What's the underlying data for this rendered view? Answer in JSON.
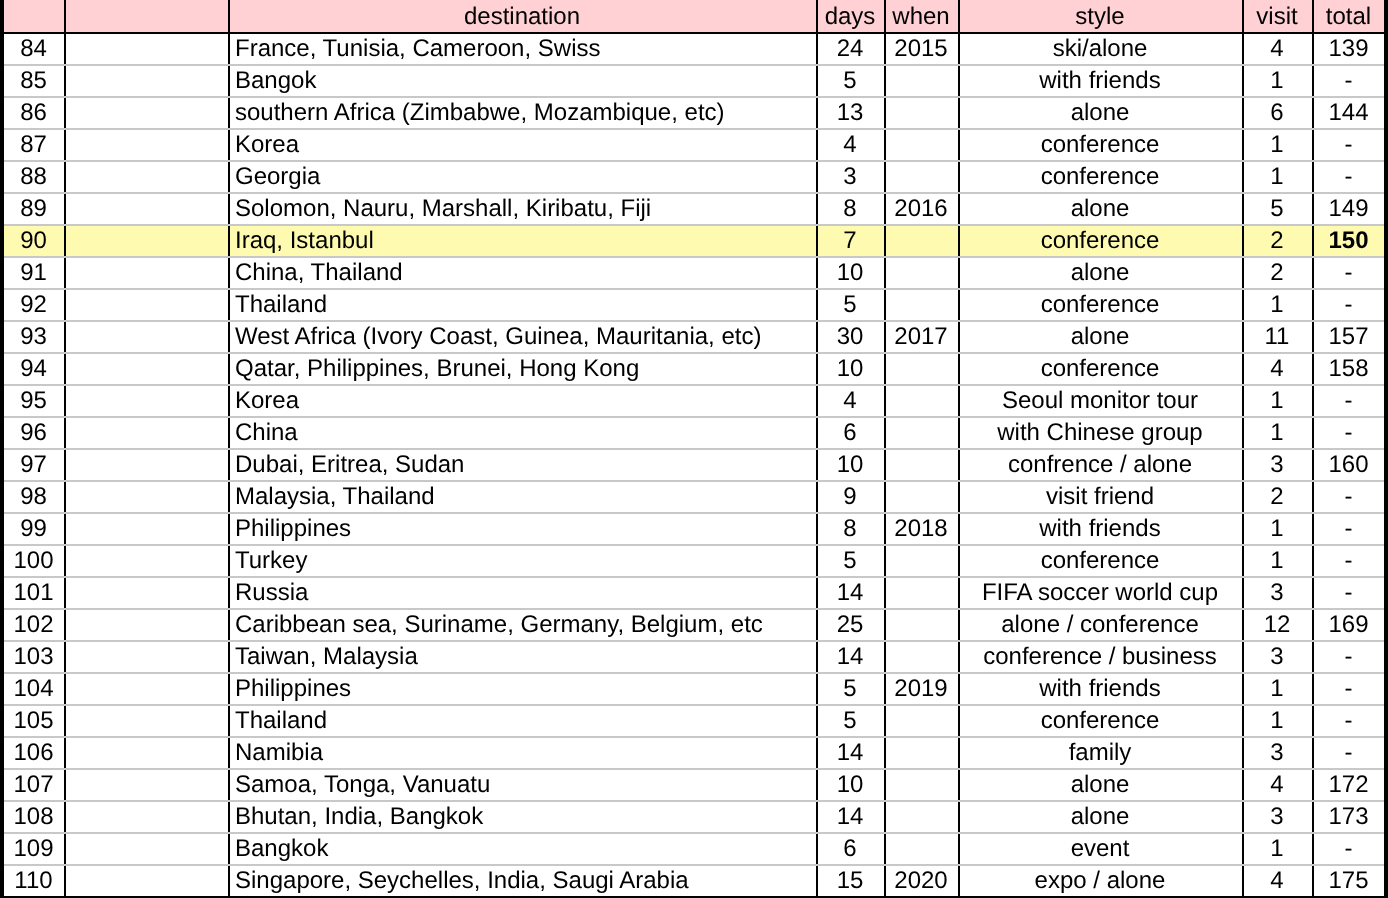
{
  "table": {
    "columns": [
      "destination",
      "days",
      "when",
      "style",
      "visit",
      "total"
    ],
    "rows": [
      {
        "no": "84",
        "destination": "France, Tunisia, Cameroon, Swiss",
        "days": "24",
        "when": "2015",
        "style": "ski/alone",
        "visit": "4",
        "total": "139",
        "highlighted": false
      },
      {
        "no": "85",
        "destination": "Bangok",
        "days": "5",
        "style": "with friends",
        "visit": "1",
        "total": "-",
        "highlighted": false
      },
      {
        "no": "86",
        "destination": "southern Africa (Zimbabwe, Mozambique, etc)",
        "days": "13",
        "style": "alone",
        "visit": "6",
        "total": "144",
        "highlighted": false
      },
      {
        "no": "87",
        "destination": "Korea",
        "days": "4",
        "style": "conference",
        "visit": "1",
        "total": "-",
        "highlighted": false
      },
      {
        "no": "88",
        "destination": "Georgia",
        "days": "3",
        "style": "conference",
        "visit": "1",
        "total": "-",
        "highlighted": false
      },
      {
        "no": "89",
        "destination": "Solomon, Nauru, Marshall, Kiribatu, Fiji",
        "days": "8",
        "when": "2016",
        "style": "alone",
        "visit": "5",
        "total": "149",
        "highlighted": false
      },
      {
        "no": "90",
        "destination": "Iraq, Istanbul",
        "days": "7",
        "style": "conference",
        "visit": "2",
        "total": "150",
        "highlighted": true
      },
      {
        "no": "91",
        "destination": "China, Thailand",
        "days": "10",
        "style": "alone",
        "visit": "2",
        "total": "-",
        "highlighted": false
      },
      {
        "no": "92",
        "destination": "Thailand",
        "days": "5",
        "style": "conference",
        "visit": "1",
        "total": "-",
        "highlighted": false
      },
      {
        "no": "93",
        "destination": "West Africa (Ivory Coast, Guinea, Mauritania, etc)",
        "days": "30",
        "when": "2017",
        "style": "alone",
        "visit": "11",
        "total": "157",
        "highlighted": false
      },
      {
        "no": "94",
        "destination": "Qatar, Philippines, Brunei, Hong Kong",
        "days": "10",
        "style": "conference",
        "visit": "4",
        "total": "158",
        "highlighted": false
      },
      {
        "no": "95",
        "destination": "Korea",
        "days": "4",
        "style": "Seoul monitor tour",
        "visit": "1",
        "total": "-",
        "highlighted": false
      },
      {
        "no": "96",
        "destination": "China",
        "days": "6",
        "style": "with Chinese group",
        "visit": "1",
        "total": "-",
        "highlighted": false
      },
      {
        "no": "97",
        "destination": "Dubai, Eritrea, Sudan",
        "days": "10",
        "style": "confrence / alone",
        "visit": "3",
        "total": "160",
        "highlighted": false
      },
      {
        "no": "98",
        "destination": "Malaysia, Thailand",
        "days": "9",
        "style": "visit friend",
        "visit": "2",
        "total": "-",
        "highlighted": false
      },
      {
        "no": "99",
        "destination": "Philippines",
        "days": "8",
        "when": "2018",
        "style": "with friends",
        "visit": "1",
        "total": "-",
        "highlighted": false
      },
      {
        "no": "100",
        "destination": "Turkey",
        "days": "5",
        "style": "conference",
        "visit": "1",
        "total": "-",
        "highlighted": false
      },
      {
        "no": "101",
        "destination": "Russia",
        "days": "14",
        "style": "FIFA soccer world cup",
        "visit": "3",
        "total": "-",
        "highlighted": false
      },
      {
        "no": "102",
        "destination": "Caribbean sea, Suriname, Germany, Belgium, etc",
        "days": "25",
        "style": "alone / conference",
        "visit": "12",
        "total": "169",
        "highlighted": false
      },
      {
        "no": "103",
        "destination": "Taiwan, Malaysia",
        "days": "14",
        "style": "conference / business",
        "visit": "3",
        "total": "-",
        "highlighted": false
      },
      {
        "no": "104",
        "destination": "Philippines",
        "days": "5",
        "when": "2019",
        "style": "with friends",
        "visit": "1",
        "total": "-",
        "highlighted": false
      },
      {
        "no": "105",
        "destination": "Thailand",
        "days": "5",
        "style": "conference",
        "visit": "1",
        "total": "-",
        "highlighted": false
      },
      {
        "no": "106",
        "destination": "Namibia",
        "days": "14",
        "style": "family",
        "visit": "3",
        "total": "-",
        "highlighted": false
      },
      {
        "no": "107",
        "destination": "Samoa, Tonga, Vanuatu",
        "days": "10",
        "style": "alone",
        "visit": "4",
        "total": "172",
        "highlighted": false
      },
      {
        "no": "108",
        "destination": "Bhutan, India, Bangkok",
        "days": "14",
        "style": "alone",
        "visit": "3",
        "total": "173",
        "highlighted": false
      },
      {
        "no": "109",
        "destination": "Bangkok",
        "days": "6",
        "style": "event",
        "visit": "1",
        "total": "-",
        "highlighted": false
      },
      {
        "no": "110",
        "destination": "Singapore, Seychelles, India, Saugi Arabia",
        "days": "15",
        "when": "2020",
        "style": "expo / alone",
        "visit": "4",
        "total": "175",
        "highlighted": false
      }
    ]
  }
}
